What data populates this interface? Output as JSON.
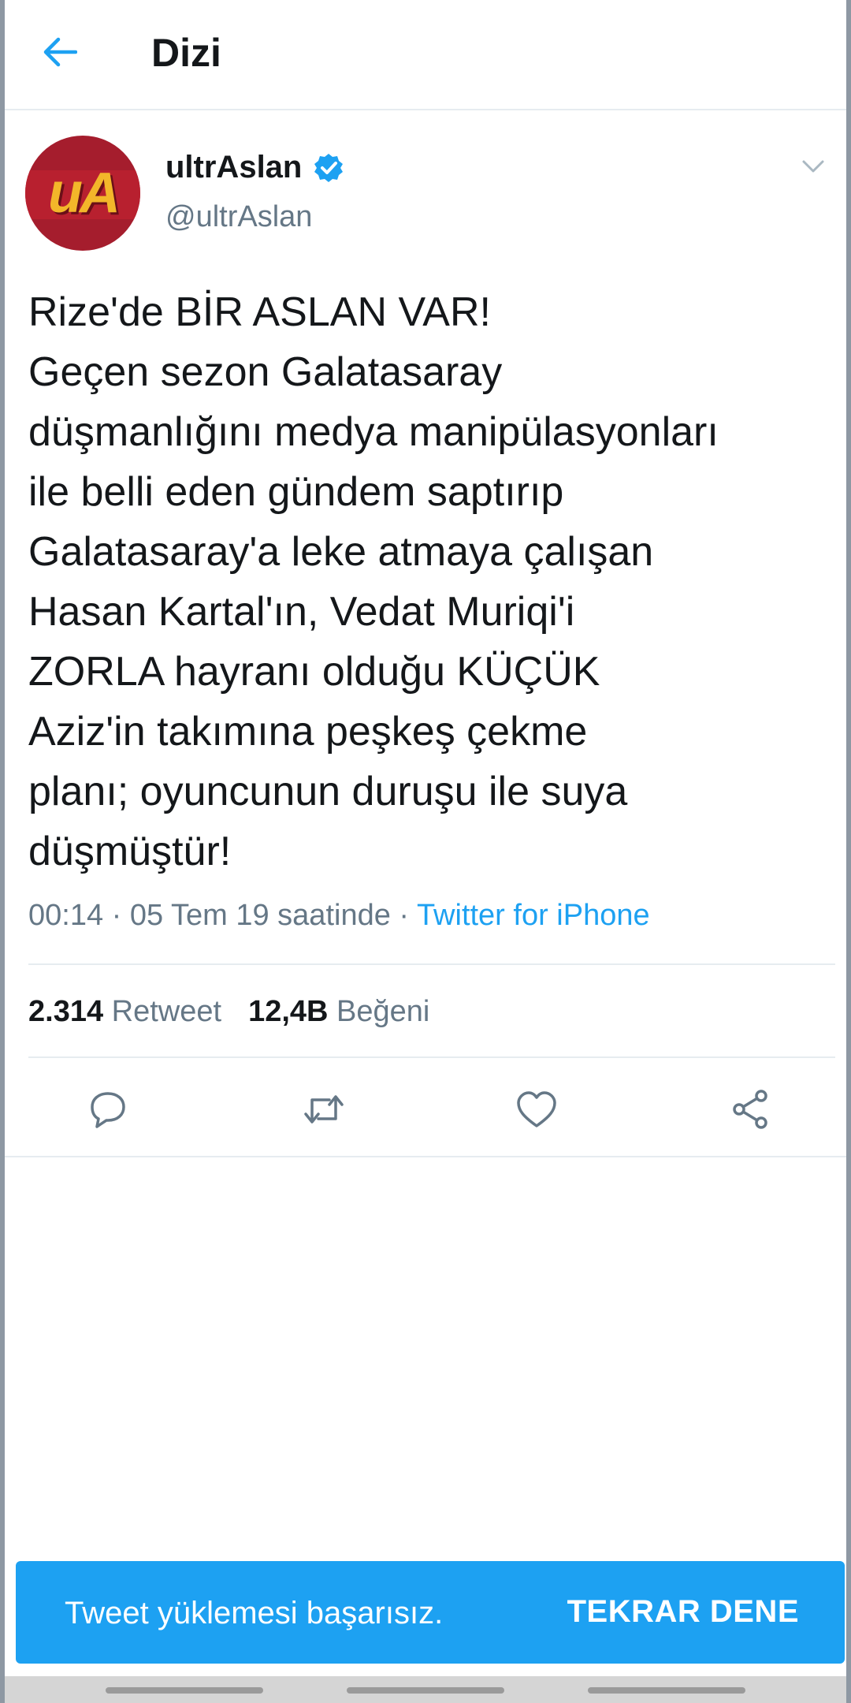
{
  "header": {
    "title": "Dizi",
    "back_icon": "arrow-left-icon"
  },
  "tweet": {
    "display_name": "ultrAslan",
    "handle": "@ultrAslan",
    "avatar_text": "uA",
    "verified": true,
    "text_lines": [
      "Rize'de BİR ASLAN VAR!",
      "Geçen sezon Galatasaray",
      "düşmanlığını medya manipülasyonları",
      "ile belli eden gündem saptırıp",
      "Galatasaray'a leke atmaya çalışan",
      "Hasan Kartal'ın, Vedat Muriqi'i",
      "ZORLA hayranı olduğu KÜÇÜK",
      "Aziz'in takımına peşkeş çekme",
      "planı; oyuncunun duruşu ile suya",
      "düşmüştür!"
    ],
    "meta_time": "00:14 · 05 Tem 19 saatinde · ",
    "meta_source": "Twitter for iPhone",
    "retweet_count": "2.314",
    "retweet_label": "Retweet",
    "like_count": "12,4B",
    "like_label": "Beğeni"
  },
  "actions": [
    {
      "icon": "reply-icon"
    },
    {
      "icon": "retweet-icon"
    },
    {
      "icon": "heart-icon"
    },
    {
      "icon": "share-icon"
    }
  ],
  "toast": {
    "message": "Tweet yüklemesi başarısız.",
    "button": "TEKRAR DENE"
  },
  "colors": {
    "accent": "#1da1f2",
    "text": "#14171a",
    "secondary": "#657786",
    "divider": "#e6ecf0"
  }
}
